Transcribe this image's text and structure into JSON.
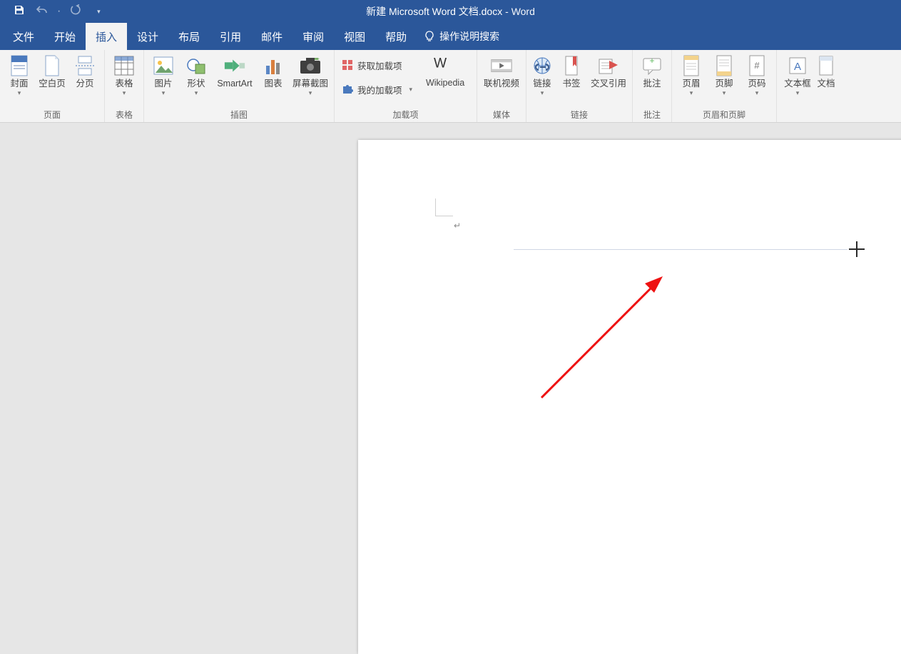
{
  "title": {
    "document": "新建 Microsoft Word 文档.docx",
    "sep": "  -  ",
    "app": "Word"
  },
  "tabs": {
    "file": "文件",
    "home": "开始",
    "insert": "插入",
    "design": "设计",
    "layout": "布局",
    "references": "引用",
    "mailings": "邮件",
    "review": "审阅",
    "view": "视图",
    "help": "帮助",
    "tell_me": "操作说明搜索"
  },
  "ribbon": {
    "groups": {
      "pages": {
        "label": "页面",
        "cover": "封面",
        "blank": "空白页",
        "pagebreak": "分页"
      },
      "tables": {
        "label": "表格",
        "table": "表格"
      },
      "illustrations": {
        "label": "插图",
        "picture": "图片",
        "shapes": "形状",
        "smartart": "SmartArt",
        "chart": "图表",
        "screenshot": "屏幕截图"
      },
      "addins": {
        "label": "加载项",
        "get": "获取加载项",
        "my": "我的加载项",
        "wikipedia": "Wikipedia"
      },
      "media": {
        "label": "媒体",
        "video": "联机视频"
      },
      "links": {
        "label": "链接",
        "link": "链接",
        "bookmark": "书签",
        "xref": "交叉引用"
      },
      "comments": {
        "label": "批注",
        "comment": "批注"
      },
      "headerfooter": {
        "label": "页眉和页脚",
        "header": "页眉",
        "footer": "页脚",
        "pagenum": "页码"
      },
      "text": {
        "textbox": "文本框",
        "wordart": "文档"
      }
    }
  },
  "page": {
    "para_mark": "↵"
  }
}
